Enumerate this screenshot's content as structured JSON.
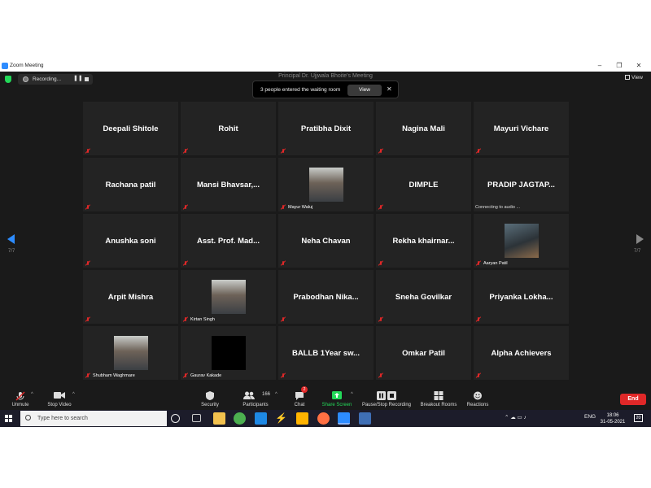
{
  "window": {
    "title": "Zoom Meeting",
    "minimize": "–",
    "maximize": "❐",
    "close": "✕"
  },
  "topbar": {
    "recording_label": "Recording...",
    "pause_glyph": "❚❚",
    "meeting_title": "Principal Dr. Ujjwala Bhoite's Meeting",
    "view_label": "View"
  },
  "waiting_room": {
    "message": "3 people entered the waiting room",
    "view_label": "View",
    "close_glyph": "✕"
  },
  "pages": {
    "left": "7/7",
    "right": "7/7"
  },
  "participants": [
    {
      "name": "Deepali Shitole"
    },
    {
      "name": "Rohit"
    },
    {
      "name": "Pratibha Dixit"
    },
    {
      "name": "Nagina Mali"
    },
    {
      "name": "Mayuri Vichare"
    },
    {
      "name": "Rachana patil"
    },
    {
      "name": "Mansi  Bhavsar,..."
    },
    {
      "label": "Mayur Waluj",
      "avatar": "person-photo"
    },
    {
      "name": "DIMPLE"
    },
    {
      "name": "PRADIP  JAGTAP...",
      "status": "Connecting to audio ..."
    },
    {
      "name": "Anushka soni"
    },
    {
      "name": "Asst. Prof. Mad..."
    },
    {
      "name": "Neha Chavan"
    },
    {
      "name": "Rekha  khairnar..."
    },
    {
      "label": "Aaryan Patil",
      "avatar": "guitar-photo"
    },
    {
      "name": "Arpit Mishra"
    },
    {
      "label": "Kirtan Singh",
      "avatar": "person-photo"
    },
    {
      "name": "Prabodhan  Nika..."
    },
    {
      "name": "Sneha Govilkar"
    },
    {
      "name": "Priyanka  Lokha..."
    },
    {
      "label": "Shubham Waghmare",
      "avatar": "person-photo"
    },
    {
      "label": "Gaurav Kakade",
      "avatar": "black-video"
    },
    {
      "name": "BALLB  1Year  sw..."
    },
    {
      "name": "Omkar Patil"
    },
    {
      "name": "Alpha Achievers"
    }
  ],
  "toolbar": {
    "unmute": "Unmute",
    "stop_video": "Stop Video",
    "security": "Security",
    "participants": "Participants",
    "participants_count": "166",
    "chat": "Chat",
    "chat_badge": "2",
    "share_screen": "Share Screen",
    "recording": "Pause/Stop Recording",
    "breakout": "Breakout Rooms",
    "reactions": "Reactions",
    "end": "End",
    "caret": "^"
  },
  "taskbar": {
    "search_placeholder": "Type here to search",
    "language": "ENG",
    "time": "18:06",
    "date": "31-05-2021",
    "notifications": "20"
  },
  "colors": {
    "accent": "#2D8CFF",
    "end_red": "#E02828",
    "share_green": "#23D959",
    "tile_bg": "#232323"
  }
}
